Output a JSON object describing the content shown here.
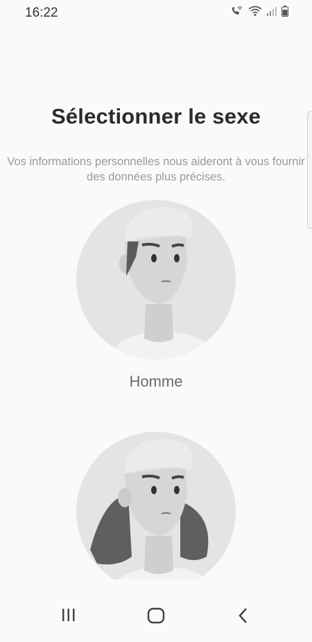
{
  "status": {
    "time": "16:22"
  },
  "screen": {
    "title": "Sélectionner le sexe",
    "subtitle": "Vos informations personnelles nous aideront à vous fournir des données plus précises."
  },
  "options": [
    {
      "label": "Homme"
    },
    {
      "label": ""
    }
  ],
  "nav": {
    "recent_icon": "recent-apps-icon",
    "home_icon": "home-icon",
    "back_icon": "back-icon"
  }
}
